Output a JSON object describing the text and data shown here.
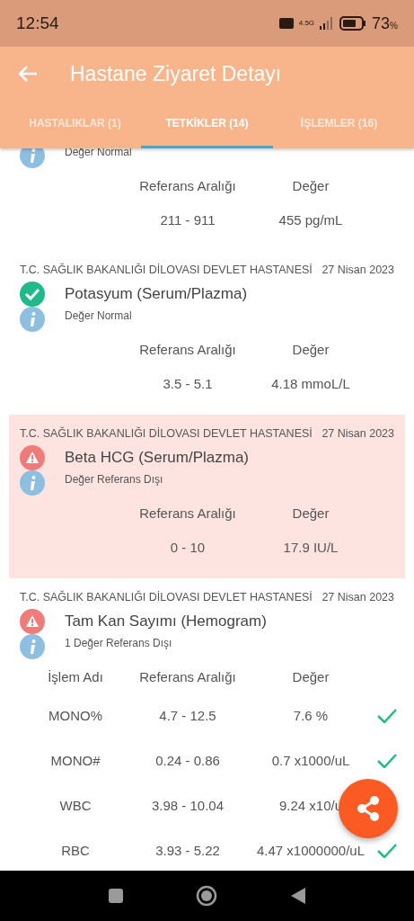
{
  "status_bar": {
    "time": "12:54",
    "network": "4.5G",
    "battery": "73",
    "battery_unit": "%"
  },
  "app_bar": {
    "title": "Hastane Ziyaret Detayı"
  },
  "tabs": [
    {
      "label": "HASTALIKLAR (1)",
      "selected": false
    },
    {
      "label": "TETKİKLER (14)",
      "selected": true
    },
    {
      "label": "İŞLEMLER (16)",
      "selected": false
    }
  ],
  "tests": [
    {
      "note": "Değer Normal",
      "highlighted": false,
      "columns": [
        "Referans Aralığı",
        "Değer"
      ],
      "rows": [
        {
          "cells": [
            "211 - 911",
            "455 pg/mL"
          ]
        }
      ]
    },
    {
      "hospital": "T.C. SAĞLIK BAKANLIĞI DİLOVASI DEVLET HASTANESİ",
      "date": "27 Nisan 2023",
      "name": "Potasyum (Serum/Plazma)",
      "kind": "normal",
      "note": "Değer Normal",
      "highlighted": false,
      "columns": [
        "Referans Aralığı",
        "Değer"
      ],
      "rows": [
        {
          "cells": [
            "3.5 - 5.1",
            "4.18 mmoL/L"
          ]
        }
      ]
    },
    {
      "hospital": "T.C. SAĞLIK BAKANLIĞI DİLOVASI DEVLET HASTANESİ",
      "date": "27 Nisan 2023",
      "name": "Beta HCG (Serum/Plazma)",
      "kind": "abnormal",
      "note": "Değer Referans Dışı",
      "highlighted": true,
      "columns": [
        "Referans Aralığı",
        "Değer"
      ],
      "rows": [
        {
          "cells": [
            "0 - 10",
            "17.9 IU/L"
          ]
        }
      ]
    },
    {
      "hospital": "T.C. SAĞLIK BAKANLIĞI DİLOVASI DEVLET HASTANESİ",
      "date": "27 Nisan 2023",
      "name": "Tam Kan Sayımı (Hemogram)",
      "kind": "abnormal",
      "note": "1 Değer Referans Dışı",
      "highlighted": false,
      "columns": [
        "İşlem Adı",
        "Referans Aralığı",
        "Değer"
      ],
      "rows": [
        {
          "cells": [
            "MONO%",
            "4.7 - 12.5",
            "7.6 %"
          ],
          "normal": true
        },
        {
          "cells": [
            "MONO#",
            "0.24 - 0.86",
            "0.7 x1000/uL"
          ],
          "normal": true
        },
        {
          "cells": [
            "WBC",
            "3.98 - 10.04",
            "9.24 x10/u"
          ]
        },
        {
          "cells": [
            "RBC",
            "3.93 - 5.22",
            "4.47 x1000000/uL"
          ],
          "normal": true
        }
      ]
    }
  ]
}
